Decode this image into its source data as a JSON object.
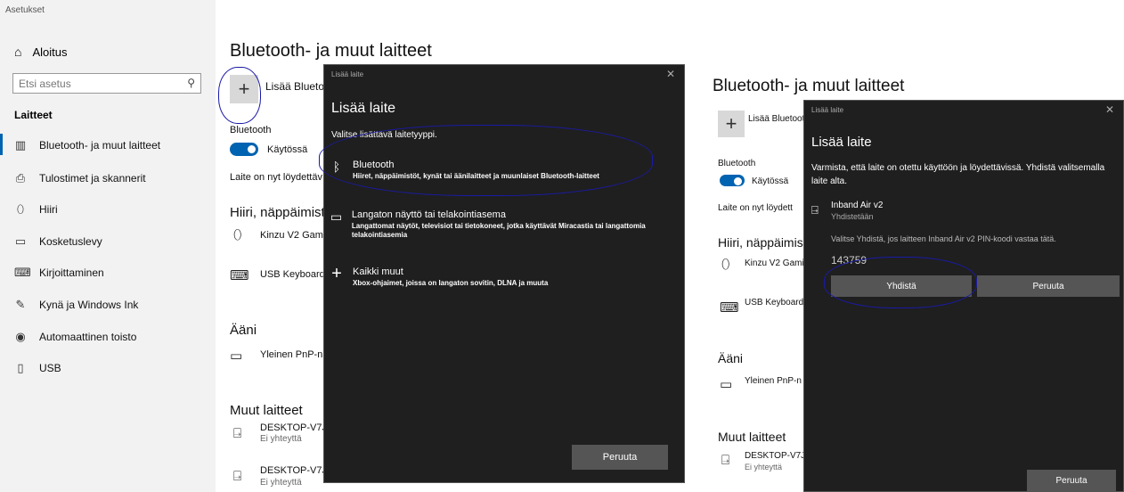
{
  "app_title": "Asetukset",
  "sidebar": {
    "home": "Aloitus",
    "search_placeholder": "Etsi asetus",
    "section": "Laitteet",
    "items": [
      {
        "label": "Bluetooth- ja muut laitteet",
        "icon": "bluetooth-devices-icon"
      },
      {
        "label": "Tulostimet ja skannerit",
        "icon": "printer-icon"
      },
      {
        "label": "Hiiri",
        "icon": "mouse-icon"
      },
      {
        "label": "Kosketuslevy",
        "icon": "touchpad-icon"
      },
      {
        "label": "Kirjoittaminen",
        "icon": "keyboard-icon"
      },
      {
        "label": "Kynä ja Windows Ink",
        "icon": "pen-icon"
      },
      {
        "label": "Automaattinen toisto",
        "icon": "autoplay-icon"
      },
      {
        "label": "USB",
        "icon": "usb-icon"
      }
    ]
  },
  "left_panel": {
    "title": "Bluetooth- ja muut laitteet",
    "add_label": "Lisää Bluetoot",
    "bluetooth_label": "Bluetooth",
    "toggle_state": "Käytössä",
    "discoverable": "Laite on nyt löydettäv",
    "mice_heading": "Hiiri, näppäimist",
    "mouse_device": "Kinzu V2 Gami",
    "keyboard_device": "USB Keyboard",
    "audio_heading": "Ääni",
    "audio_device": "Yleinen PnP-n",
    "other_heading": "Muut laitteet",
    "other_devices": [
      {
        "name": "DESKTOP-V7J5",
        "status": "Ei yhteyttä"
      },
      {
        "name": "DESKTOP-V7J5",
        "status": "Ei yhteyttä"
      }
    ]
  },
  "dialog1": {
    "caption": "Lisää laite",
    "title": "Lisää laite",
    "subtitle": "Valitse lisättävä laitetyyppi.",
    "options": [
      {
        "title": "Bluetooth",
        "desc": "Hiiret, näppäimistöt, kynät tai äänilaitteet ja muunlaiset Bluetooth-laitteet",
        "icon": "bluetooth-icon"
      },
      {
        "title": "Langaton näyttö tai telakointiasema",
        "desc": "Langattomat näytöt, televisiot tai tietokoneet, jotka käyttävät Miracastia tai langattomia telakointiasemia",
        "icon": "monitor-icon"
      },
      {
        "title": "Kaikki muut",
        "desc": "Xbox-ohjaimet, joissa on langaton sovitin, DLNA ja muuta",
        "icon": "plus-icon"
      }
    ],
    "cancel": "Peruuta"
  },
  "right_panel": {
    "title": "Bluetooth- ja muut laitteet",
    "add_label": "Lisää Bluetoot",
    "bluetooth_label": "Bluetooth",
    "toggle_state": "Käytössä",
    "discoverable": "Laite on nyt löydett",
    "mice_heading": "Hiiri, näppäimist",
    "mouse_device": "Kinzu V2 Gami",
    "keyboard_device": "USB Keyboard",
    "audio_heading": "Ääni",
    "audio_device": "Yleinen PnP-n",
    "other_heading": "Muut laitteet",
    "other_device": {
      "name": "DESKTOP-V7J5",
      "status": "Ei yhteyttä"
    }
  },
  "dialog2": {
    "caption": "Lisää laite",
    "title": "Lisää laite",
    "instruction": "Varmista, että laite on otettu käyttöön ja löydettävissä. Yhdistä valitsemalla laite alta.",
    "device_name": "Inband Air v2",
    "device_status": "Yhdistetään",
    "pin_prompt": "Valitse Yhdistä, jos laitteen  Inband Air v2 PIN-koodi vastaa tätä.",
    "pin": "143759",
    "connect": "Yhdistä",
    "cancel_inline": "Peruuta",
    "cancel": "Peruuta"
  }
}
